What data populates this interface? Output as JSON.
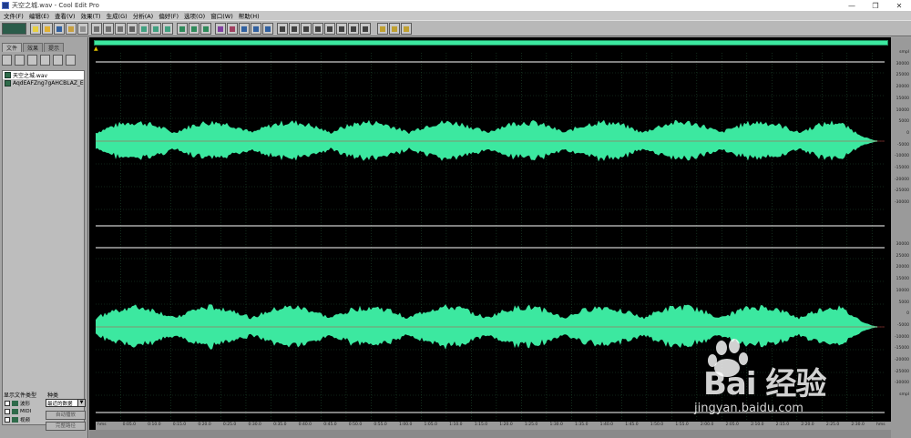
{
  "window": {
    "title": "天空之城.wav - Cool Edit Pro",
    "controls": [
      "—",
      "❐",
      "✕"
    ]
  },
  "menu": [
    "文件(F)",
    "编辑(E)",
    "查看(V)",
    "效果(T)",
    "生成(G)",
    "分析(A)",
    "偏好(F)",
    "选项(O)",
    "窗口(W)",
    "帮助(H)"
  ],
  "left_panel": {
    "tabs": [
      "文件",
      "效果",
      "提示"
    ],
    "files": [
      "天空之城.wav",
      "AqdEAFZng7gAHCBLAZ_E"
    ],
    "filter_label": "显示文件类型",
    "sort_label": "种类",
    "sort_value": "最近的数据",
    "filters": [
      "波形",
      "MIDI",
      "视频"
    ],
    "button_auto_play": "自动播放",
    "button_full_path": "完整路径"
  },
  "amplitude_labels_top": [
    "smpl",
    "30000",
    "25000",
    "20000",
    "15000",
    "10000",
    "5000",
    "0",
    "-5000",
    "-10000",
    "-15000",
    "-20000",
    "-25000",
    "-30000"
  ],
  "amplitude_labels_bottom": [
    "30000",
    "25000",
    "20000",
    "15000",
    "10000",
    "5000",
    "0",
    "-5000",
    "-10000",
    "-15000",
    "-20000",
    "-25000",
    "-30000",
    "smpl"
  ],
  "time_labels": [
    "hms",
    "0:05.0",
    "0:10.0",
    "0:15.0",
    "0:20.0",
    "0:25.0",
    "0:30.0",
    "0:35.0",
    "0:40.0",
    "0:45.0",
    "0:50.0",
    "0:55.0",
    "1:00.0",
    "1:05.0",
    "1:10.0",
    "1:15.0",
    "1:20.0",
    "1:25.0",
    "1:30.0",
    "1:35.0",
    "1:40.0",
    "1:45.0",
    "1:50.0",
    "1:55.0",
    "2:00.0",
    "2:05.0",
    "2:10.0",
    "2:15.0",
    "2:20.0",
    "2:25.0",
    "2:30.0",
    "hms"
  ],
  "colors": {
    "waveform": "#3ce8a0",
    "background": "#000000",
    "grid": "#1f4a2f",
    "selection_line": "#ffffff"
  },
  "logo": {
    "wordmark": "Bai 经验",
    "subtitle": "jingyan.baidu.com"
  }
}
